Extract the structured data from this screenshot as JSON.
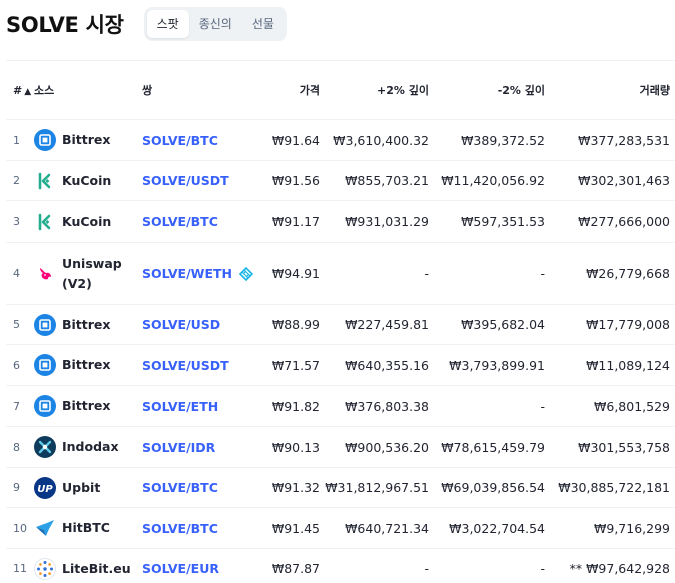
{
  "header": {
    "title": "SOLVE 시장",
    "tabs": [
      "스팟",
      "종신의",
      "선물"
    ],
    "active_tab": "스팟"
  },
  "table": {
    "columns": {
      "rank": "#",
      "source": "소스",
      "pair": "쌍",
      "price": "가격",
      "depth_plus": "+2% 깊이",
      "depth_minus": "-2% 깊이",
      "volume": "거래량"
    },
    "sort_indicator": "▲",
    "rows": [
      {
        "rank": "1",
        "exchange": "Bittrex",
        "logo": "bittrex-logo-icon",
        "pair": "SOLVE/BTC",
        "price": "₩91.64",
        "depth_plus": "₩3,610,400.32",
        "depth_minus": "₩389,372.52",
        "volume": "₩377,283,531"
      },
      {
        "rank": "2",
        "exchange": "KuCoin",
        "logo": "kucoin-logo-icon",
        "pair": "SOLVE/USDT",
        "price": "₩91.56",
        "depth_plus": "₩855,703.21",
        "depth_minus": "₩11,420,056.92",
        "volume": "₩302,301,463"
      },
      {
        "rank": "3",
        "exchange": "KuCoin",
        "logo": "kucoin-logo-icon",
        "pair": "SOLVE/BTC",
        "price": "₩91.17",
        "depth_plus": "₩931,031.29",
        "depth_minus": "₩597,351.53",
        "volume": "₩277,666,000"
      },
      {
        "rank": "4",
        "exchange": "Uniswap (V2)",
        "logo": "uniswap-logo-icon",
        "pair": "SOLVE/WETH",
        "price": "₩94.91",
        "depth_plus": "-",
        "depth_minus": "-",
        "volume": "₩26,779,668"
      },
      {
        "rank": "5",
        "exchange": "Bittrex",
        "logo": "bittrex-logo-icon",
        "pair": "SOLVE/USD",
        "price": "₩88.99",
        "depth_plus": "₩227,459.81",
        "depth_minus": "₩395,682.04",
        "volume": "₩17,779,008"
      },
      {
        "rank": "6",
        "exchange": "Bittrex",
        "logo": "bittrex-logo-icon",
        "pair": "SOLVE/USDT",
        "price": "₩71.57",
        "depth_plus": "₩640,355.16",
        "depth_minus": "₩3,793,899.91",
        "volume": "₩11,089,124"
      },
      {
        "rank": "7",
        "exchange": "Bittrex",
        "logo": "bittrex-logo-icon",
        "pair": "SOLVE/ETH",
        "price": "₩91.82",
        "depth_plus": "₩376,803.38",
        "depth_minus": "-",
        "volume": "₩6,801,529"
      },
      {
        "rank": "8",
        "exchange": "Indodax",
        "logo": "indodax-logo-icon",
        "pair": "SOLVE/IDR",
        "price": "₩90.13",
        "depth_plus": "₩900,536.20",
        "depth_minus": "₩78,615,459.79",
        "volume": "₩301,553,758"
      },
      {
        "rank": "9",
        "exchange": "Upbit",
        "logo": "upbit-logo-icon",
        "pair": "SOLVE/BTC",
        "price": "₩91.32",
        "depth_plus": "₩31,812,967.51",
        "depth_minus": "₩69,039,856.54",
        "volume": "₩30,885,722,181"
      },
      {
        "rank": "10",
        "exchange": "HitBTC",
        "logo": "hitbtc-logo-icon",
        "pair": "SOLVE/BTC",
        "price": "₩91.45",
        "depth_plus": "₩640,721.34",
        "depth_minus": "₩3,022,704.54",
        "volume": "₩9,716,299"
      },
      {
        "rank": "11",
        "exchange": "LiteBit.eu",
        "logo": "litebit-logo-icon",
        "pair": "SOLVE/EUR",
        "price": "₩87.87",
        "depth_plus": "-",
        "depth_minus": "-",
        "volume": "** ₩97,642,928"
      }
    ]
  },
  "colors": {
    "link": "#3861fb",
    "tab_bg": "#eff2f5",
    "divider": "#eff2f5",
    "muted": "#58667e"
  }
}
